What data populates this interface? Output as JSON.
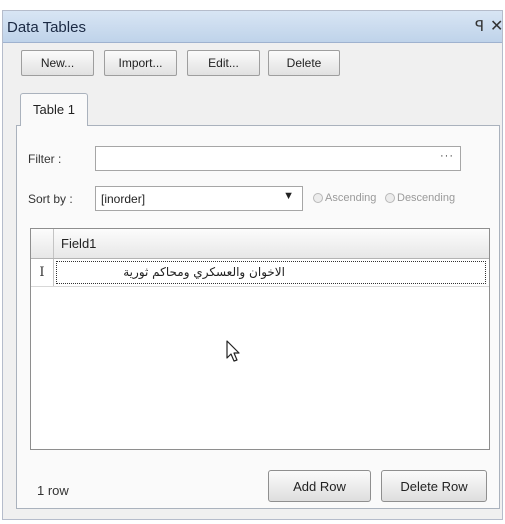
{
  "window": {
    "title": "Data Tables",
    "pin_icon": "pin-icon",
    "close_icon": "close-icon",
    "pin_glyph": "ꟼ",
    "close_glyph": "✕"
  },
  "toolbar": {
    "new_label": "New...",
    "import_label": "Import...",
    "edit_label": "Edit...",
    "delete_label": "Delete"
  },
  "tabs": [
    {
      "label": "Table 1",
      "selected": true
    }
  ],
  "filter": {
    "label": "Filter :",
    "value": "",
    "button": "···"
  },
  "sort": {
    "label": "Sort by :",
    "selected": "[inorder]",
    "dropdown_icon": "chevron-down-icon",
    "ascending_label": "Ascending",
    "descending_label": "Descending"
  },
  "grid": {
    "columns": [
      "Field1"
    ],
    "rows": [
      {
        "marker": "I",
        "cells": [
          "الاخوان والعسكري ومحاكم ثورية"
        ]
      }
    ]
  },
  "footer": {
    "row_count": "1 row",
    "add_row_label": "Add Row",
    "delete_row_label": "Delete Row"
  },
  "colors": {
    "titlebar": "#c9daef",
    "panel_bg": "#f0f0f0",
    "border": "#aab2bd"
  }
}
